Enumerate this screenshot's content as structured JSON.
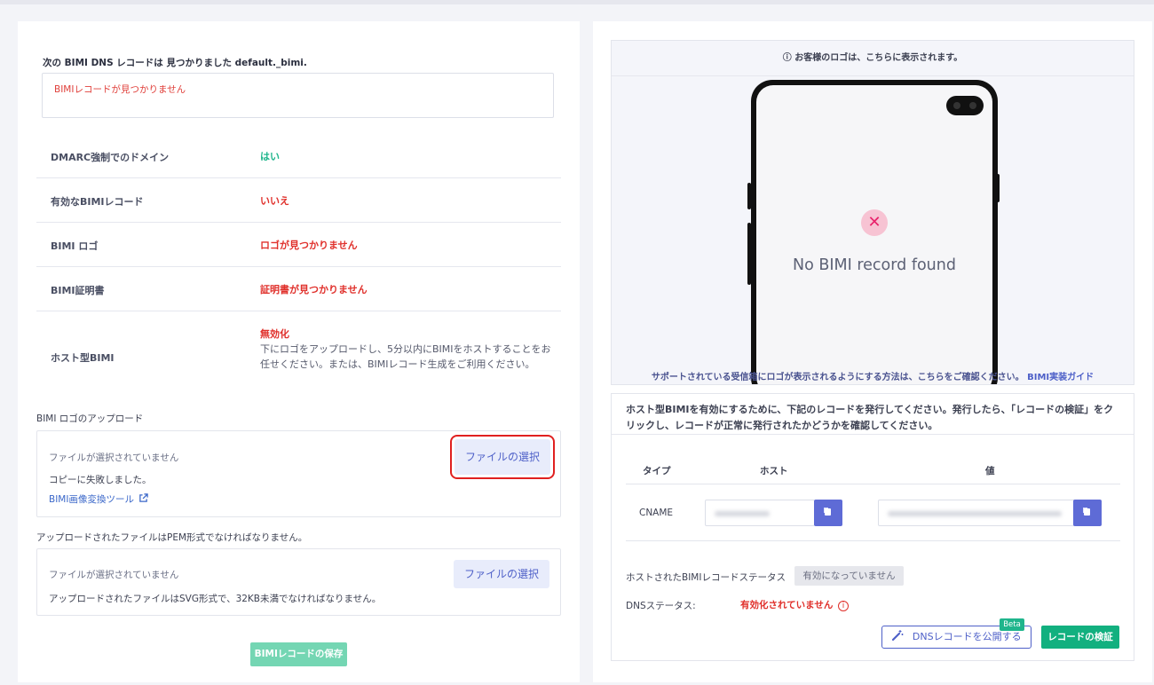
{
  "left": {
    "found_label": "次の BIMI DNS レコードは 見つかりました default._bimi.",
    "record_text": "BIMIレコードが見つかりません",
    "rows": [
      {
        "key": "DMARC強制でのドメイン",
        "value": "はい"
      },
      {
        "key": "有効なBIMIレコード",
        "value": "いいえ"
      },
      {
        "key": "BIMI ロゴ",
        "value": "ロゴが見つかりません"
      },
      {
        "key": "BIMI証明書",
        "value": "証明書が見つかりません"
      }
    ],
    "hosted": {
      "key": "ホスト型BIMI",
      "value": "無効化",
      "desc": "下にロゴをアップロードし、5分以内にBIMIをホストすることをお任せください。または、BIMIレコード生成をご利用ください。"
    },
    "logo_upload": {
      "label": "BIMI ロゴのアップロード",
      "no_file": "ファイルが選択されていません",
      "button": "ファイルの選択",
      "note": "コピーに失敗しました。",
      "link": "BIMI画像変換ツール"
    },
    "cert_upload": {
      "label": "アップロードされたファイルはPEM形式でなければなりません。",
      "no_file": "ファイルが選択されていません",
      "button": "ファイルの選択",
      "note": "アップロードされたファイルはSVG形式で、32KB未満でなければなりません。"
    },
    "save_button": "BIMIレコードの保存"
  },
  "right": {
    "preview_header": "ⓘ お客様のロゴは、こちらに表示されます。",
    "no_record": "No BIMI record found",
    "support_text": "サポートされている受信箱にロゴが表示されるようにする方法は、こちらをご確認ください。",
    "guide_link": "BIMI実装ガイド",
    "host_intro": "ホスト型BIMIを有効にするために、下記のレコードを発行してください。発行したら、「レコードの検証」をクリックし、レコードが正常に発行されたかどうかを確認してください。",
    "table": {
      "headers": [
        "タイプ",
        "ホスト",
        "値"
      ],
      "type": "CNAME"
    },
    "status_label": "ホストされたBIMIレコードステータス",
    "status_value": "有効になっていません",
    "dns_label": "DNSステータス:",
    "dns_value": "有効化されていません",
    "publish_button": "DNSレコードを公開する",
    "beta": "Beta",
    "verify_button": "レコードの検証"
  },
  "colors": {
    "accent": "#4e60c8",
    "success": "#1fb58c",
    "error": "#e0302b"
  }
}
